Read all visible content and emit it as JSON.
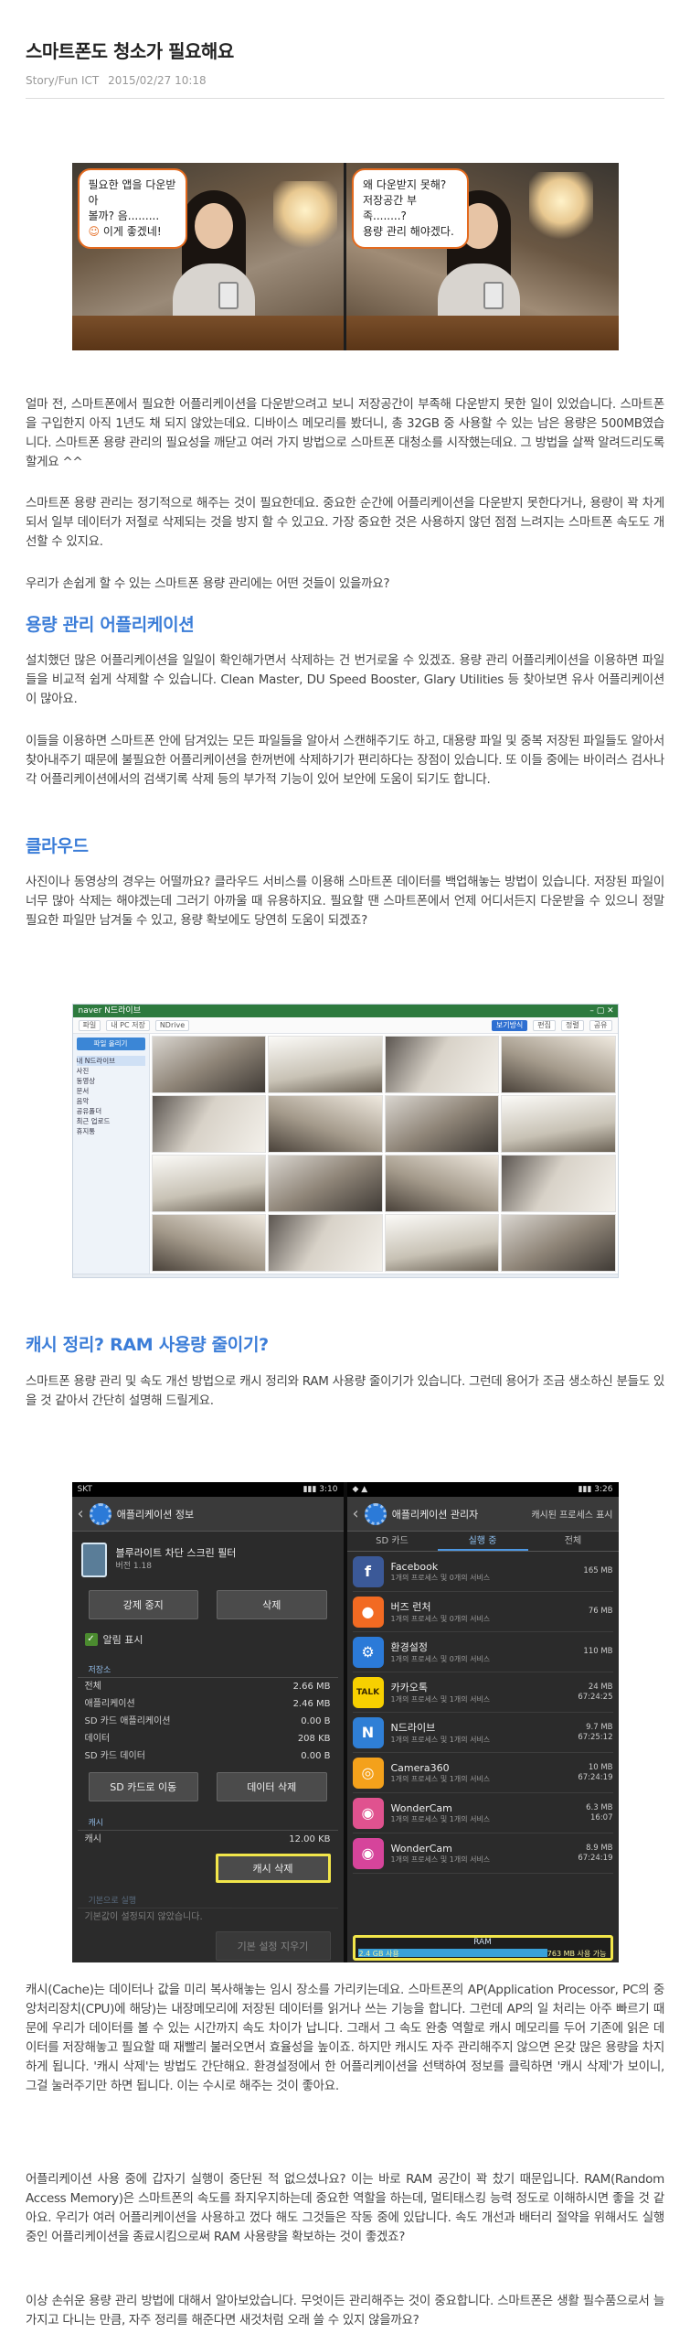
{
  "post": {
    "title": "스마트폰도 청소가 필요해요",
    "category": "Story/Fun ICT",
    "date": "2015/02/27 10:18"
  },
  "figure1": {
    "bubble_left": [
      "필요한 앱을 다운받아",
      "볼까? 음.........",
      "이게 좋겠네!"
    ],
    "bubble_right": [
      "왜 다운받지 못해?",
      "저장공간 부족........?",
      "용량 관리 해야겠다."
    ]
  },
  "paragraphs": {
    "p1": "얼마 전, 스마트폰에서 필요한 어플리케이션을 다운받으려고 보니 저장공간이 부족해 다운받지 못한 일이 있었습니다. 스마트폰을 구입한지 아직 1년도 채 되지 않았는데요. 디바이스 메모리를 봤더니, 총 32GB 중 사용할 수 있는 남은 용량은 500MB였습니다. 스마트폰 용량 관리의 필요성을 깨닫고 여러 가지 방법으로 스마트폰 대청소를 시작했는데요. 그 방법을 살짝 알려드리도록 할게요 ^^",
    "p2": "스마트폰 용량 관리는 정기적으로 해주는 것이 필요한데요. 중요한 순간에 어플리케이션을 다운받지 못한다거나, 용량이 꽉 차게 되서 일부 데이터가 저절로 삭제되는 것을 방지 할 수 있고요. 가장 중요한 것은 사용하지 않던 점점 느려지는 스마트폰 속도도 개선할 수 있지요.",
    "p3": "우리가 손쉽게 할 수 있는 스마트폰 용량 관리에는 어떤 것들이 있을까요?",
    "p4": "설치했던 많은 어플리케이션을 일일이 확인해가면서 삭제하는 건 번거로울 수 있겠죠. 용량 관리 어플리케이션을 이용하면 파일들을 비교적 쉽게 삭제할 수 있습니다. Clean Master, DU Speed Booster, Glary Utilities 등 찾아보면 유사 어플리케이션이 많아요.",
    "p5": "이들을 이용하면 스마트폰 안에 담겨있는 모든 파일들을 알아서 스캔해주기도 하고, 대용량 파일 및 중복 저장된 파일들도 알아서 찾아내주기 때문에 불필요한 어플리케이션을 한꺼번에 삭제하기가 편리하다는 장점이 있습니다. 또 이들 중에는 바이러스 검사나 각 어플리케이션에서의 검색기록 삭제 등의 부가적 기능이 있어 보안에 도움이 되기도 합니다.",
    "p6": "사진이나 동영상의 경우는 어떨까요? 클라우드 서비스를 이용해 스마트폰 데이터를 백업해놓는 방법이 있습니다. 저장된 파일이 너무 많아 삭제는 해야겠는데 그러기 아까울 때 유용하지요. 필요할 땐 스마트폰에서 언제 어디서든지 다운받을 수 있으니 정말 필요한 파일만 남겨둘 수 있고, 용량 확보에도 당연히 도움이 되겠죠?",
    "p7": "스마트폰 용량 관리 및 속도 개선 방법으로 캐시 정리와 RAM 사용량 줄이기가 있습니다. 그런데 용어가 조금 생소하신 분들도 있을 것 같아서 간단히 설명해 드릴게요.",
    "p8": "캐시(Cache)는 데이터나 값을 미리 복사해놓는 임시 장소를 가리키는데요. 스마트폰의 AP(Application Processor, PC의 중앙처리장치(CPU)에 해당)는 내장메모리에 저장된 데이터를 읽거나 쓰는 기능을 합니다. 그런데 AP의 일 처리는 아주 빠르기 때문에 우리가 데이터를 볼 수 있는 시간까지 속도 차이가 납니다. 그래서 그 속도 완충 역할로 캐시 메모리를 두어 기존에 읽은 데이터를 저장해놓고 필요할 때 재빨리 불러오면서 효율성을 높이죠. 하지만 캐시도 자주 관리해주지 않으면 온갖 많은 용량을 차지하게 됩니다. '캐시 삭제'는 방법도 간단해요. 환경설정에서 한 어플리케이션을 선택하여 정보를 클릭하면 '캐시 삭제'가 보이니, 그걸 눌러주기만 하면 됩니다. 이는 수시로 해주는 것이 좋아요.",
    "p9": "어플리케이션 사용 중에 갑자기 실행이 중단된 적 없으셨나요? 이는 바로 RAM 공간이 꽉 찼기 때문입니다. RAM(Random Access Memory)은 스마트폰의 속도를 좌지우지하는데 중요한 역할을 하는데, 멀티태스킹 능력 정도로 이해하시면 좋을 것 같아요. 우리가 여러 어플리케이션을 사용하고 껐다 해도 그것들은 작동 중에 있답니다. 속도 개선과 배터리 절약을 위해서도 실행중인 어플리케이션을 종료시킴으로써 RAM 사용량을 확보하는 것이 좋겠죠?",
    "p10": "이상 손쉬운 용량 관리 방법에 대해서 알아보았습니다. 무엇이든 관리해주는 것이 중요합니다. 스마트폰은 생활 필수품으로서 늘 가지고 다니는 만큼, 자주 정리를 해준다면 새것처럼 오래 쓸 수 있지 않을까요?"
  },
  "headings": {
    "h1": "용량 관리 어플리케이션",
    "h2": "클라우드",
    "h3": "캐시 정리? RAM 사용량 줄이기?"
  },
  "figure2": {
    "title_bar": "naver N드라이브",
    "toolbar": [
      "파일",
      "내 PC 저장",
      "NDrive",
      "보기방식",
      "편집",
      "정렬",
      "공유"
    ],
    "side_button": "파일 올리기",
    "side_rows": [
      "내 N드라이브",
      "사진",
      "동영상",
      "문서",
      "음악",
      "공유폴더",
      "최근 업로드",
      "휴지통"
    ]
  },
  "figure3": {
    "left": {
      "status_left": "SKT",
      "status_right": "3:10",
      "title": "애플리케이션 정보",
      "app_name": "블루라이트 차단 스크린 필터",
      "app_version": "버전 1.18",
      "btn_force": "강제 중지",
      "btn_delete": "삭제",
      "notify_label": "알림 표시",
      "storage_label": "저장소",
      "rows": [
        {
          "k": "전체",
          "v": "2.66 MB"
        },
        {
          "k": "애플리케이션",
          "v": "2.46 MB"
        },
        {
          "k": "SD 카드 애플리케이션",
          "v": "0.00 B"
        },
        {
          "k": "데이터",
          "v": "208 KB"
        },
        {
          "k": "SD 카드 데이터",
          "v": "0.00 B"
        }
      ],
      "btn_sd": "SD 카드로 이동",
      "btn_data": "데이터 삭제",
      "cache_label": "캐시",
      "cache_key": "캐시",
      "cache_value": "12.00 KB",
      "btn_cache": "캐시 삭제",
      "default_label": "기본으로 실행",
      "default_text": "기본값이 설정되지 않았습니다.",
      "btn_default": "기본 설정 지우기"
    },
    "right": {
      "status_right": "3:26",
      "title": "애플리케이션 관리자",
      "right_label": "캐시된 프로세스 표시",
      "tabs": [
        "SD 카드",
        "실행 중",
        "전체"
      ],
      "apps": [
        {
          "name": "Facebook",
          "sub": "1개의 프로세스 및 0개의 서비스",
          "size": "165 MB",
          "time": "",
          "icon": "f",
          "color": "#3b5998"
        },
        {
          "name": "버즈 런처",
          "sub": "1개의 프로세스 및 0개의 서비스",
          "size": "76 MB",
          "time": "",
          "icon": "●",
          "color": "#f26a22"
        },
        {
          "name": "환경설정",
          "sub": "1개의 프로세스 및 0개의 서비스",
          "size": "110 MB",
          "time": "",
          "icon": "⚙",
          "color": "#2b7ad8"
        },
        {
          "name": "카카오톡",
          "sub": "1개의 프로세스 및 1개의 서비스",
          "size": "24 MB",
          "time": "67:24:25",
          "icon": "TALK",
          "color": "#f7d000"
        },
        {
          "name": "N드라이브",
          "sub": "1개의 프로세스 및 1개의 서비스",
          "size": "9.7 MB",
          "time": "67:25:12",
          "icon": "N",
          "color": "#2f7fd6"
        },
        {
          "name": "Camera360",
          "sub": "1개의 프로세스 및 1개의 서비스",
          "size": "10 MB",
          "time": "67:24:19",
          "icon": "◎",
          "color": "#f4a11b"
        },
        {
          "name": "WonderCam",
          "sub": "1개의 프로세스 및 1개의 서비스",
          "size": "6.3 MB",
          "time": "16:07",
          "icon": "◉",
          "color": "#e0528f"
        },
        {
          "name": "WonderCam",
          "sub": "1개의 프로세스 및 1개의 서비스",
          "size": "8.9 MB",
          "time": "67:24:19",
          "icon": "◉",
          "color": "#d6449b"
        }
      ],
      "ram_label": "RAM",
      "ram_used": "2.4 GB 사용",
      "ram_free": "763 MB 사용 가능",
      "ram_used_fraction": 0.76
    }
  }
}
